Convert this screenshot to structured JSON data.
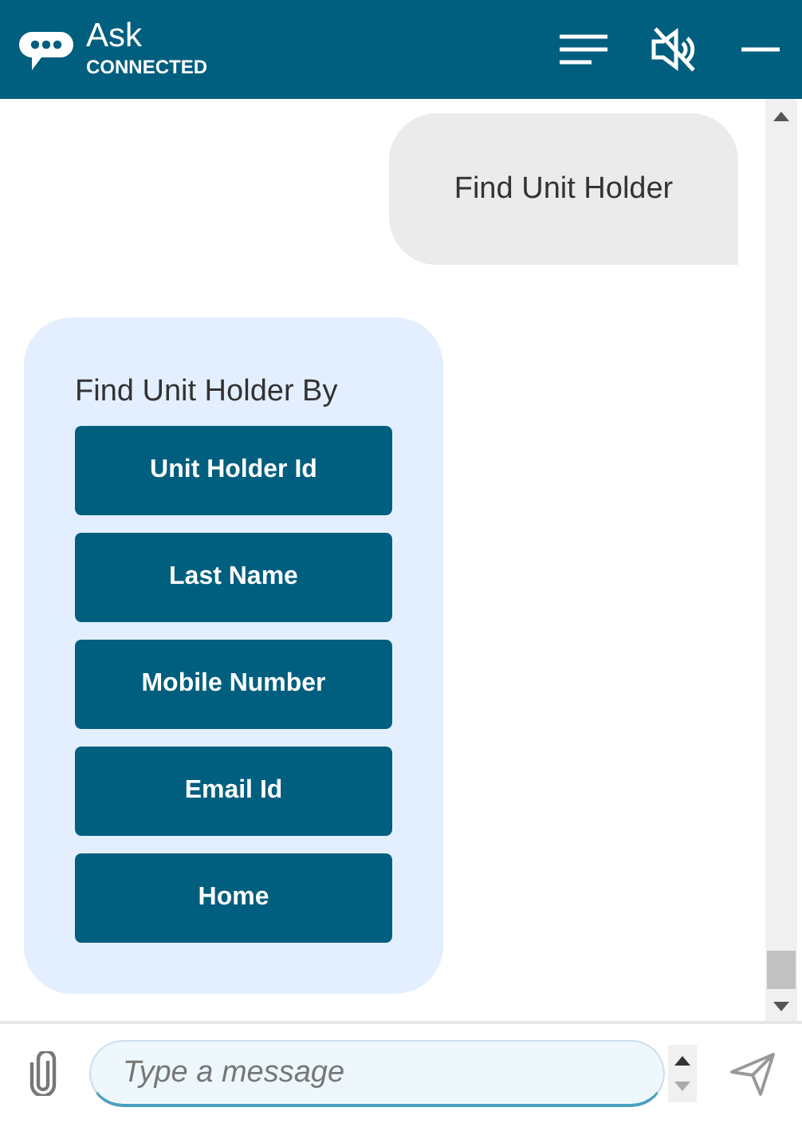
{
  "header": {
    "title": "Ask",
    "status": "CONNECTED"
  },
  "messages": [
    {
      "kind": "user",
      "text": "Find Unit Holder"
    },
    {
      "kind": "bot",
      "text": "Find Unit Holder By",
      "buttons": [
        "Unit Holder Id",
        "Last Name",
        "Mobile Number",
        "Email Id",
        "Home"
      ]
    }
  ],
  "composer": {
    "placeholder": "Type a message"
  }
}
